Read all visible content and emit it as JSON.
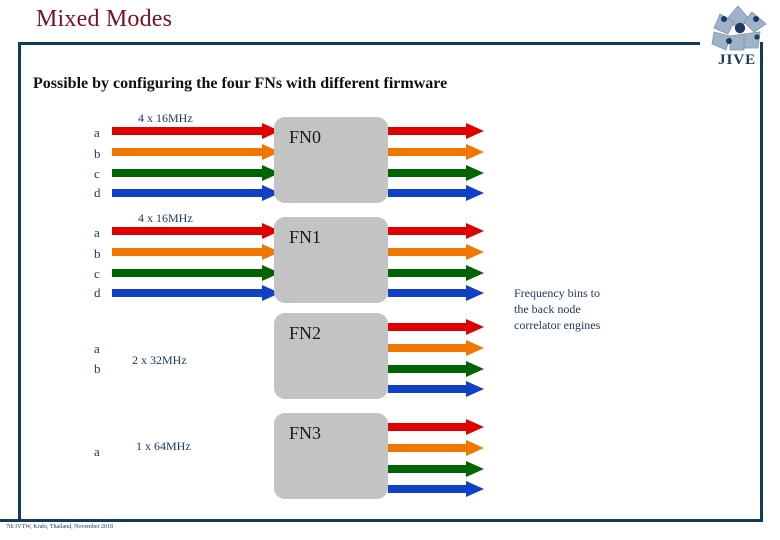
{
  "slide": {
    "title": "Mixed Modes",
    "heading": "Possible by configuring the four FNs with different firmware",
    "footer": "7th IVTW, Krabi, Thailand, November 2018"
  },
  "logo": {
    "name": "jive-logo",
    "wordmark": "JIVE",
    "color": "#2A4B6E"
  },
  "colors": {
    "accent_border": "#123A5C",
    "title": "#7B1220",
    "label_blue": "#1F3864",
    "box_gray": "#C3C3C3",
    "channel_red": "#E00000",
    "channel_orange": "#F07800",
    "channel_green": "#006400",
    "channel_blue": "#1040C8"
  },
  "annotation": {
    "line1": "Frequency bins to",
    "line2": "the back node",
    "line3": "correlator engines"
  },
  "rows": [
    {
      "id": "fn0",
      "box_label": "FN0",
      "freq_label": "4 x 16MHz",
      "channel_labels": [
        "a",
        "b",
        "c",
        "d"
      ],
      "has_inputs": true,
      "output_count": 4
    },
    {
      "id": "fn1",
      "box_label": "FN1",
      "freq_label": "4 x 16MHz",
      "channel_labels": [
        "a",
        "b",
        "c",
        "d"
      ],
      "has_inputs": true,
      "output_count": 4
    },
    {
      "id": "fn2",
      "box_label": "FN2",
      "freq_label": "2 x 32MHz",
      "channel_labels": [
        "a",
        "b"
      ],
      "has_inputs": false,
      "output_count": 4
    },
    {
      "id": "fn3",
      "box_label": "FN3",
      "freq_label": "1 x 64MHz",
      "channel_labels": [
        "a"
      ],
      "has_inputs": false,
      "output_count": 4
    }
  ]
}
